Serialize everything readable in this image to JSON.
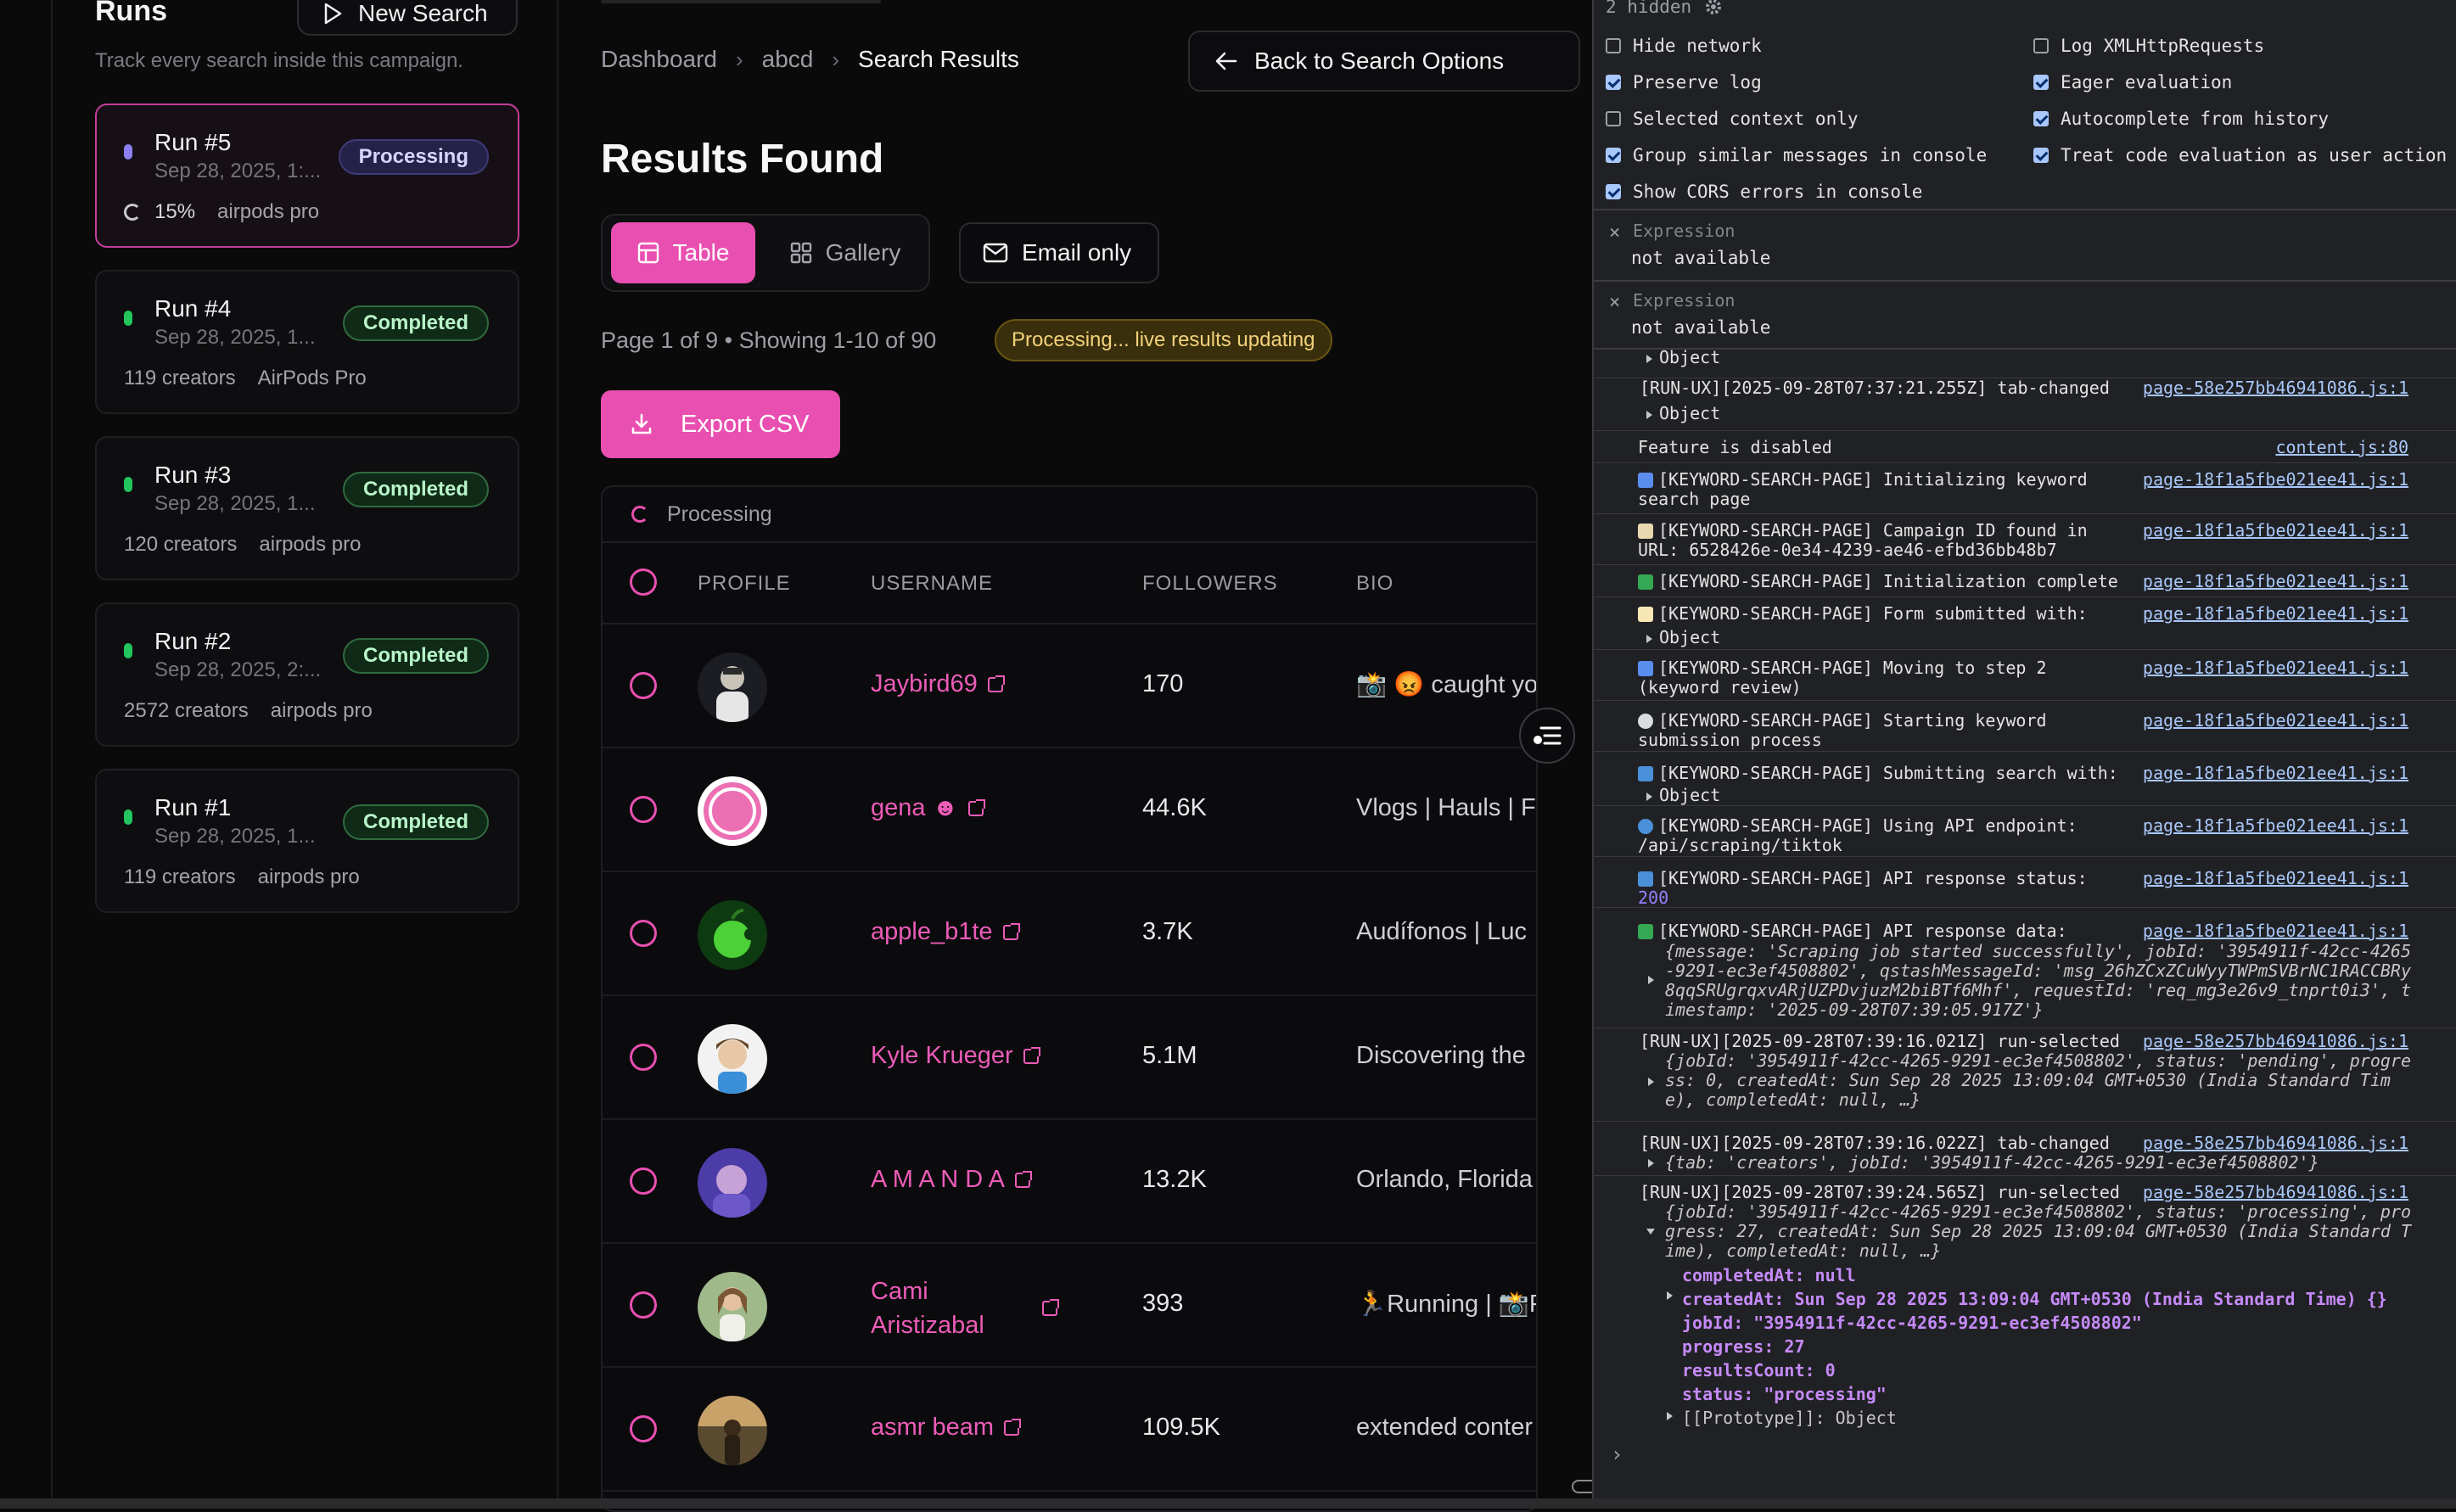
{
  "runs": {
    "title": "Runs",
    "new_search": "New Search",
    "subtitle": "Track every search inside this campaign.",
    "items": [
      {
        "name": "Run #5",
        "date": "Sep 28, 2025, 1:...",
        "status": "Processing",
        "progress": "15%",
        "query": "airpods pro",
        "active": true
      },
      {
        "name": "Run #4",
        "date": "Sep 28, 2025, 1...",
        "status": "Completed",
        "count": "119 creators",
        "query": "AirPods Pro"
      },
      {
        "name": "Run #3",
        "date": "Sep 28, 2025, 1...",
        "status": "Completed",
        "count": "120 creators",
        "query": "airpods pro"
      },
      {
        "name": "Run #2",
        "date": "Sep 28, 2025, 2:...",
        "status": "Completed",
        "count": "2572 creators",
        "query": "airpods pro"
      },
      {
        "name": "Run #1",
        "date": "Sep 28, 2025, 1...",
        "status": "Completed",
        "count": "119 creators",
        "query": "airpods pro"
      }
    ]
  },
  "breadcrumb": [
    "Dashboard",
    "abcd",
    "Search Results"
  ],
  "back_button": "Back to Search Options",
  "results_title": "Results Found",
  "view_tabs": {
    "table": "Table",
    "gallery": "Gallery"
  },
  "email_only": "Email only",
  "page_info": "Page 1 of 9 • Showing 1-10 of 90",
  "live_badge": "Processing... live results updating",
  "export_button": "Export CSV",
  "table": {
    "processing": "Processing",
    "columns": [
      "PROFILE",
      "USERNAME",
      "FOLLOWERS",
      "BIO"
    ],
    "rows": [
      {
        "username": "Jaybird69",
        "followers": "170",
        "bio": "📸 😡 caught you"
      },
      {
        "username": "gena ☻",
        "followers": "44.6K",
        "bio": "Vlogs | Hauls | F"
      },
      {
        "username": "apple_b1te",
        "followers": "3.7K",
        "bio": "Audífonos | Luc"
      },
      {
        "username": "Kyle Krueger",
        "followers": "5.1M",
        "bio": "Discovering the"
      },
      {
        "username": "A M A N D A",
        "followers": "13.2K",
        "bio": "Orlando, Florida"
      },
      {
        "username": "Cami Aristizabal",
        "followers": "393",
        "bio": "🏃Running | 📸Pl"
      },
      {
        "username": "asmr beam",
        "followers": "109.5K",
        "bio": "extended conter"
      }
    ]
  },
  "devtools": {
    "hidden": "2 hidden",
    "settings_left": [
      {
        "label": "Hide network",
        "checked": false
      },
      {
        "label": "Preserve log",
        "checked": true
      },
      {
        "label": "Selected context only",
        "checked": false
      },
      {
        "label": "Group similar messages in console",
        "checked": true
      },
      {
        "label": "Show CORS errors in console",
        "checked": true
      }
    ],
    "settings_right": [
      {
        "label": "Log XMLHttpRequests",
        "checked": false
      },
      {
        "label": "Eager evaluation",
        "checked": true
      },
      {
        "label": "Autocomplete from history",
        "checked": true
      },
      {
        "label": "Treat code evaluation as user action",
        "checked": true
      }
    ],
    "expressions": [
      {
        "label": "Expression",
        "value": "not available"
      },
      {
        "label": "Expression",
        "value": "not available"
      }
    ],
    "src_a": "page-58e257bb46941086.js:1",
    "src_b": "page-18f1a5fbe021ee41.js:1",
    "src_c": "content.js:80",
    "logs": {
      "l0": "Object",
      "l1a": "[RUN-UX][2025-09-28T07:37:21.255Z] tab-changed",
      "l1b": "Object",
      "l2": "Feature is disabled",
      "l3a": "[KEYWORD-SEARCH-PAGE] Initializing keyword",
      "l3b": "search page",
      "l4a": "[KEYWORD-SEARCH-PAGE] Campaign ID found in",
      "l4b": "URL: 6528426e-0e34-4239-ae46-efbd36bb48b7",
      "l5": "[KEYWORD-SEARCH-PAGE] Initialization complete",
      "l6a": "[KEYWORD-SEARCH-PAGE] Form submitted with:",
      "l6b": "Object",
      "l7a": "[KEYWORD-SEARCH-PAGE] Moving to step 2",
      "l7b": "(keyword review)",
      "l8a": "[KEYWORD-SEARCH-PAGE] Starting keyword",
      "l8b": "submission process",
      "l9a": "[KEYWORD-SEARCH-PAGE] Submitting search with:",
      "l9b": "Object",
      "l10a": "[KEYWORD-SEARCH-PAGE] Using API endpoint:",
      "l10b": "/api/scraping/tiktok",
      "l11a": "[KEYWORD-SEARCH-PAGE] API response status:",
      "l11b": "200",
      "l12a": "[KEYWORD-SEARCH-PAGE] API response data:",
      "l12b": "{message: 'Scraping job started successfully', jobId: '3954911f-42cc-4265",
      "l12c": "-9291-ec3ef4508802', qstashMessageId: 'msg_26hZCxZCuWyyTWPmSVBrNC1RACCBRy",
      "l12d": "8qqSRUgrqxvARjUZPDvjuzM2biBTf6Mhf', requestId: 'req_mg3e26v9_tnprt0i3', t",
      "l12e": "imestamp: '2025-09-28T07:39:05.917Z'}",
      "l13a": "[RUN-UX][2025-09-28T07:39:16.021Z] run-selected",
      "l13b": "{jobId: '3954911f-42cc-4265-9291-ec3ef4508802', status: 'pending', progre",
      "l13c": "ss: 0, createdAt: Sun Sep 28 2025 13:09:04 GMT+0530 (India Standard Tim",
      "l13d": "e), completedAt: null, …}",
      "l14a": "[RUN-UX][2025-09-28T07:39:16.022Z] tab-changed",
      "l14b": "{tab: 'creators', jobId: '3954911f-42cc-4265-9291-ec3ef4508802'}",
      "l15a": "[RUN-UX][2025-09-28T07:39:24.565Z] run-selected",
      "l15b": "{jobId: '3954911f-42cc-4265-9291-ec3ef4508802', status: 'processing', pro",
      "l15c": "gress: 27, createdAt: Sun Sep 28 2025 13:09:04 GMT+0530 (India Standard T",
      "l15d": "ime), completedAt: null, …}",
      "p_completedAt": "completedAt: null",
      "p_createdAt": "createdAt: Sun Sep 28 2025 13:09:04 GMT+0530 (India Standard Time) {}",
      "p_jobId": "jobId: \"3954911f-42cc-4265-9291-ec3ef4508802\"",
      "p_progress": "progress: 27",
      "p_results": "resultsCount: 0",
      "p_status": "status: \"processing\"",
      "p_proto": "[[Prototype]]: Object"
    }
  }
}
